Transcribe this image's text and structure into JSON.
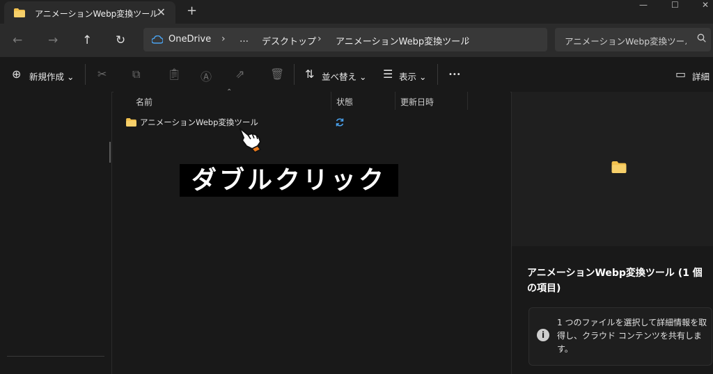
{
  "window": {
    "tab_title": "アニメーションWebp変換ツール",
    "tab_close": "✕",
    "new_tab": "+",
    "minimize": "—",
    "maximize": "☐",
    "close": "✕"
  },
  "nav": {
    "back": "←",
    "forward": "→",
    "up": "↑",
    "refresh": "↻"
  },
  "breadcrumb": [
    {
      "label": "OneDrive"
    },
    {
      "label": "…"
    },
    {
      "label": "デスクトップ"
    },
    {
      "label": "アニメーションWebp変換ツール"
    }
  ],
  "breadcrumb_sep": "›",
  "search": {
    "placeholder": "アニメーションWebp変換ツールの検索",
    "icon": "search-icon"
  },
  "toolbar": {
    "new": "新規作成",
    "sort": "並べ替え",
    "view": "表示",
    "more": "•••",
    "details": "詳細",
    "chevron": "⌄"
  },
  "columns": {
    "name": "名前",
    "status": "状態",
    "modified": "更新日時"
  },
  "files": [
    {
      "name": "アニメーションWebp変換ツール",
      "type": "folder",
      "status": "sync-icon"
    }
  ],
  "overlay_caption": "ダブルクリック",
  "details": {
    "title": "アニメーションWebp変換ツール (1 個の項目)",
    "info_icon": "i",
    "info_text": "1 つのファイルを選択して詳細情報を取得し、クラウド コンテンツを共有します。"
  },
  "colors": {
    "folder": "#f2c14e",
    "accent": "#4aa3f0",
    "background": "#191919"
  }
}
